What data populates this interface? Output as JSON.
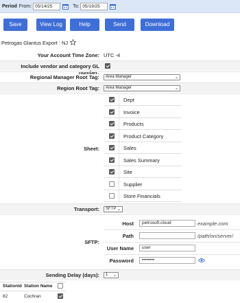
{
  "period": {
    "label": "Period",
    "from_label": "From:",
    "from_value": "05/14/25",
    "to_label": "To:",
    "to_value": "05/19/25"
  },
  "toolbar": {
    "save": "Save",
    "view_log": "View Log",
    "help": "Help",
    "send": "Send",
    "download": "Download"
  },
  "export_title": "Petrogas Glantus Export : NJ",
  "settings": {
    "timezone_label": "Your Account Time Zone:",
    "timezone_value": "UTC -4",
    "vendor_gl_label": "Include vendor and category GL number:",
    "vendor_gl_checked": true,
    "regional_root_label": "Regional Manager Root Tag:",
    "regional_root_value": "Area Manager",
    "region_root_label": "Region Root Tag:",
    "region_root_value": "Area Manager",
    "sheet_label": "Sheet:",
    "transport_label": "Transport:",
    "transport_value": "SFTP",
    "sftp_label": "SFTP:",
    "delay_label": "Sending Delay (days):",
    "delay_value": "1"
  },
  "sheets": [
    {
      "name": "Dept",
      "checked": true
    },
    {
      "name": "Invoice",
      "checked": true
    },
    {
      "name": "Products",
      "checked": true
    },
    {
      "name": "Product Category",
      "checked": true
    },
    {
      "name": "Sales",
      "checked": true
    },
    {
      "name": "Sales Summary",
      "checked": true
    },
    {
      "name": "Site",
      "checked": true
    },
    {
      "name": "Supplier",
      "checked": false
    },
    {
      "name": "Store Financials",
      "checked": false
    }
  ],
  "sftp": {
    "host_label": "Host",
    "host_value": "petrosoft.cloud",
    "host_hint": "example.com",
    "path_label": "Path",
    "path_value": "",
    "path_hint": "/path/on/server/",
    "user_label": "User Name",
    "user_value": "user",
    "password_label": "Password",
    "password_value": "••••••••"
  },
  "stations": {
    "col_id": "StationId",
    "col_name": "Station Name",
    "rows": [
      {
        "id": "82",
        "name": "Cochran",
        "checked": true
      }
    ]
  },
  "colors": {
    "button": "#3f6ed6",
    "period_bar": "#dbe7f7",
    "accent": "#3f6ed6"
  }
}
